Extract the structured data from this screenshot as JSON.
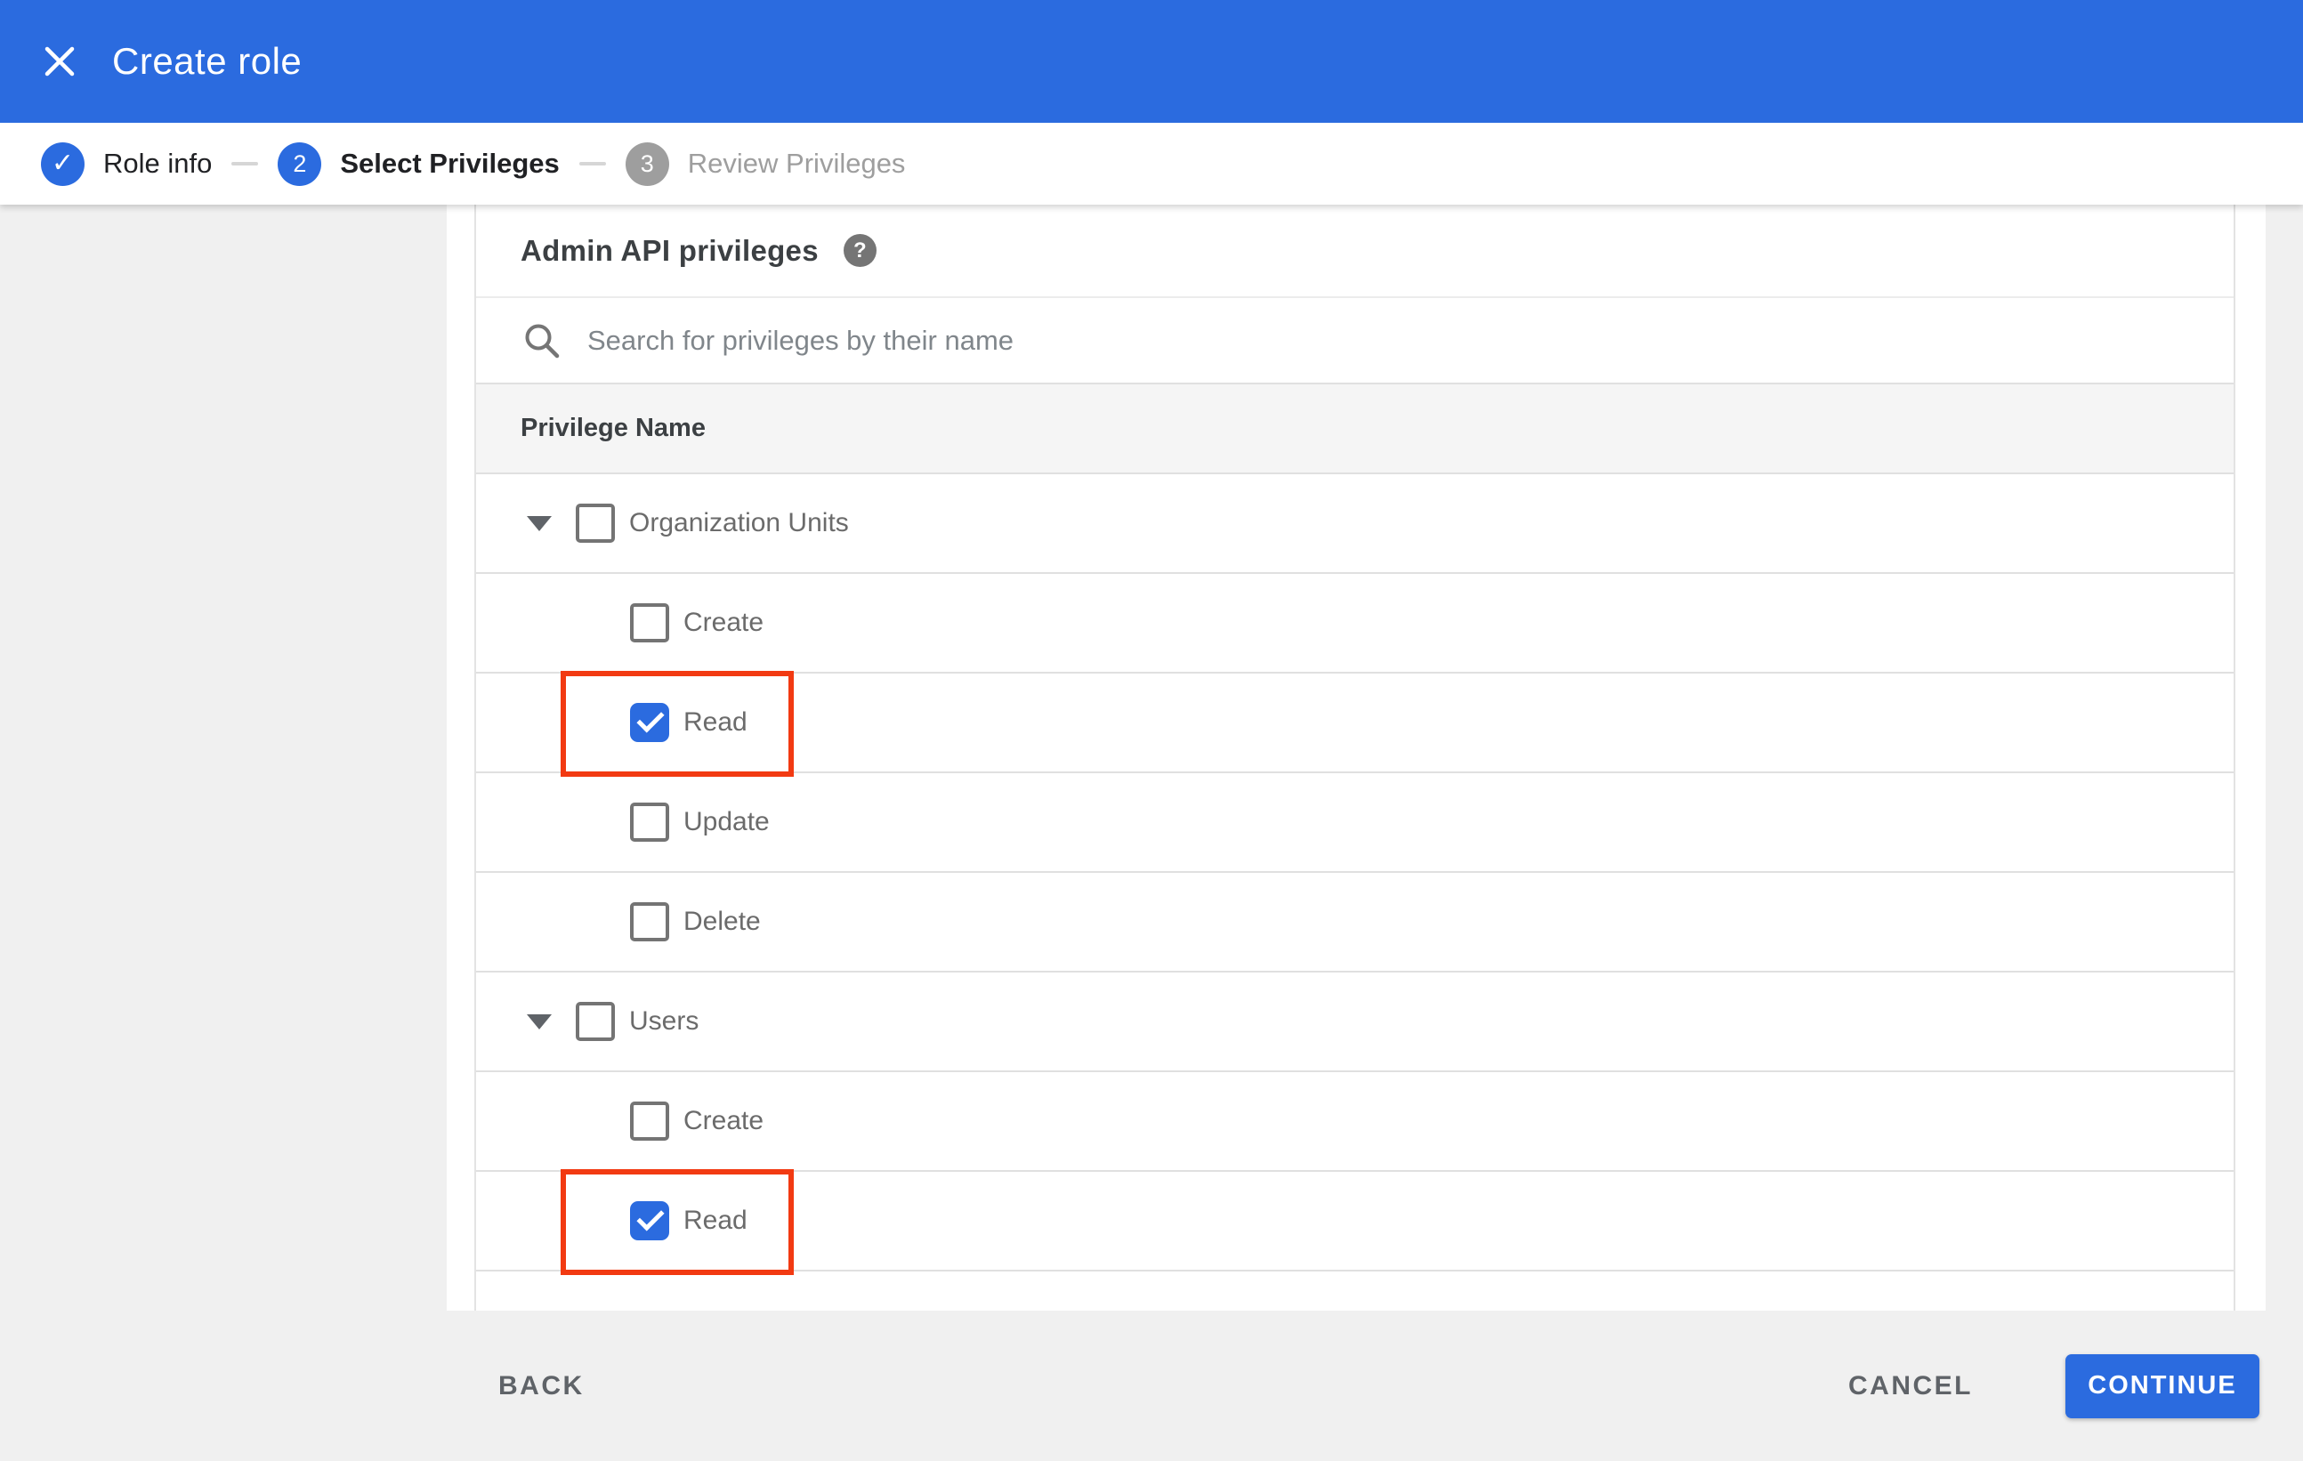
{
  "colors": {
    "accent_blue": "#2b6bdf",
    "highlight_red": "#f23a12",
    "appbar_background": "#2b6bdf",
    "footer_background": "#f0f0f0",
    "table_header_background": "#f5f5f5"
  },
  "icons": {
    "close": "x-mark",
    "search": "magnifier",
    "help": "question-mark-in-circle",
    "expand": "triangle-down",
    "step_done": "checkmark-in-circle"
  },
  "appbar": {
    "title": "Create role"
  },
  "stepper": {
    "steps": [
      {
        "indicator": "✓",
        "label": "Role info",
        "state": "completed"
      },
      {
        "indicator": "2",
        "label": "Select Privileges",
        "state": "active"
      },
      {
        "indicator": "3",
        "label": "Review Privileges",
        "state": "upcoming"
      }
    ]
  },
  "panel": {
    "heading": "Admin API privileges",
    "help_icon_glyph": "?",
    "search": {
      "placeholder": "Search for privileges by their name",
      "value": ""
    },
    "table": {
      "header": "Privilege Name",
      "rows": [
        {
          "label": "Organization Units",
          "level": "group",
          "checked": false,
          "expanded": true,
          "highlighted": false
        },
        {
          "label": "Create",
          "level": "child",
          "checked": false,
          "highlighted": false
        },
        {
          "label": "Read",
          "level": "child",
          "checked": true,
          "highlighted": true
        },
        {
          "label": "Update",
          "level": "child",
          "checked": false,
          "highlighted": false
        },
        {
          "label": "Delete",
          "level": "child",
          "checked": false,
          "highlighted": false
        },
        {
          "label": "Users",
          "level": "group",
          "checked": false,
          "expanded": true,
          "highlighted": false
        },
        {
          "label": "Create",
          "level": "child",
          "checked": false,
          "highlighted": false
        },
        {
          "label": "Read",
          "level": "child",
          "checked": true,
          "highlighted": true
        }
      ]
    }
  },
  "footer": {
    "back_label": "BACK",
    "cancel_label": "CANCEL",
    "continue_label": "CONTINUE"
  }
}
